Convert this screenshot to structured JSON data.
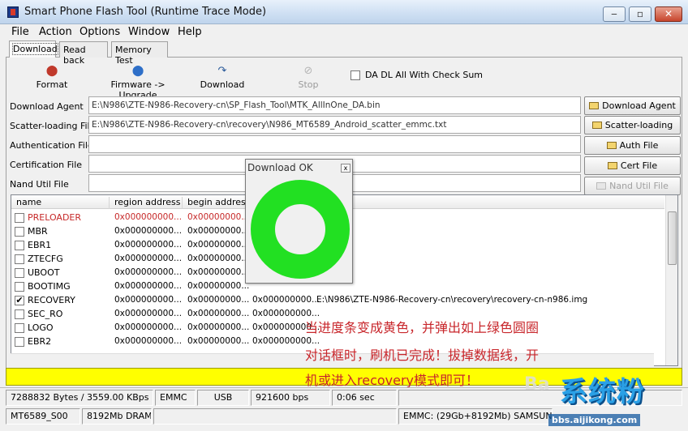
{
  "window": {
    "title": "Smart Phone Flash Tool (Runtime Trace Mode)"
  },
  "menu": [
    "File",
    "Action",
    "Options",
    "Window",
    "Help"
  ],
  "tabs": [
    "Download",
    "Read back",
    "Memory Test"
  ],
  "toolbar": {
    "format": "Format",
    "upgrade": "Firmware -> Upgrade",
    "download": "Download",
    "stop": "Stop",
    "checksum": "DA DL All With Check Sum"
  },
  "files": {
    "download_agent": {
      "label": "Download Agent",
      "value": "E:\\N986\\ZTE-N986-Recovery-cn\\SP_Flash_Tool\\MTK_AllInOne_DA.bin",
      "button": "Download Agent"
    },
    "scatter": {
      "label": "Scatter-loading File",
      "value": "E:\\N986\\ZTE-N986-Recovery-cn\\recovery\\N986_MT6589_Android_scatter_emmc.txt",
      "button": "Scatter-loading"
    },
    "auth": {
      "label": "Authentication File",
      "value": "",
      "button": "Auth File"
    },
    "cert": {
      "label": "Certification File",
      "value": "",
      "button": "Cert File"
    },
    "nand": {
      "label": "Nand Util File",
      "value": "",
      "button": "Nand Util File"
    }
  },
  "table": {
    "columns": [
      "name",
      "region address",
      "begin address"
    ],
    "rows": [
      {
        "name": "PRELOADER",
        "region": "0x000000000...",
        "begin": "0x00000000...",
        "end": "",
        "file": ""
      },
      {
        "name": "MBR",
        "region": "0x000000000...",
        "begin": "0x00000000...",
        "end": "",
        "file": ""
      },
      {
        "name": "EBR1",
        "region": "0x000000000...",
        "begin": "0x00000000...",
        "end": "",
        "file": ""
      },
      {
        "name": "ZTECFG",
        "region": "0x000000000...",
        "begin": "0x00000000...",
        "end": "",
        "file": ""
      },
      {
        "name": "UBOOT",
        "region": "0x000000000...",
        "begin": "0x00000000...",
        "end": "",
        "file": ""
      },
      {
        "name": "BOOTIMG",
        "region": "0x000000000...",
        "begin": "0x00000000...",
        "end": "",
        "file": ""
      },
      {
        "name": "RECOVERY",
        "region": "0x000000000...",
        "begin": "0x00000000...",
        "end": "0x000000000...",
        "file": "E:\\N986\\ZTE-N986-Recovery-cn\\recovery\\recovery-cn-n986.img"
      },
      {
        "name": "SEC_RO",
        "region": "0x000000000...",
        "begin": "0x00000000...",
        "end": "0x000000000...",
        "file": ""
      },
      {
        "name": "LOGO",
        "region": "0x000000000...",
        "begin": "0x00000000...",
        "end": "0x000000000...",
        "file": ""
      },
      {
        "name": "EBR2",
        "region": "0x000000000...",
        "begin": "0x00000000...",
        "end": "0x000000000...",
        "file": ""
      }
    ]
  },
  "dialog": {
    "title": "Download OK",
    "close": "x"
  },
  "caption": {
    "line1": "当进度条变成黄色，并弹出如上绿色圆圈",
    "line2": "对话框时，刷机已完成！拔掉数据线，开",
    "line3": "机或进入recovery模式即可！"
  },
  "progress": {
    "percent": 100,
    "color": "#ffff00"
  },
  "status": {
    "bytes": "7288832 Bytes / 3559.00 KBps",
    "storage": "EMMC",
    "port": "USB",
    "baud": "921600 bps",
    "time": "0:06 sec",
    "chip": "MT6589_S00",
    "dram": "8192Mb DRAM",
    "emmc": "EMMC: (29Gb+8192Mb) SAMSUN"
  },
  "watermark": {
    "main": "系统粉",
    "sub": "bbs.aijikong.com",
    "baidu": "Ba"
  },
  "colors": {
    "ring": "#22e022",
    "progress": "#ffff00",
    "caption": "#c8262b"
  }
}
